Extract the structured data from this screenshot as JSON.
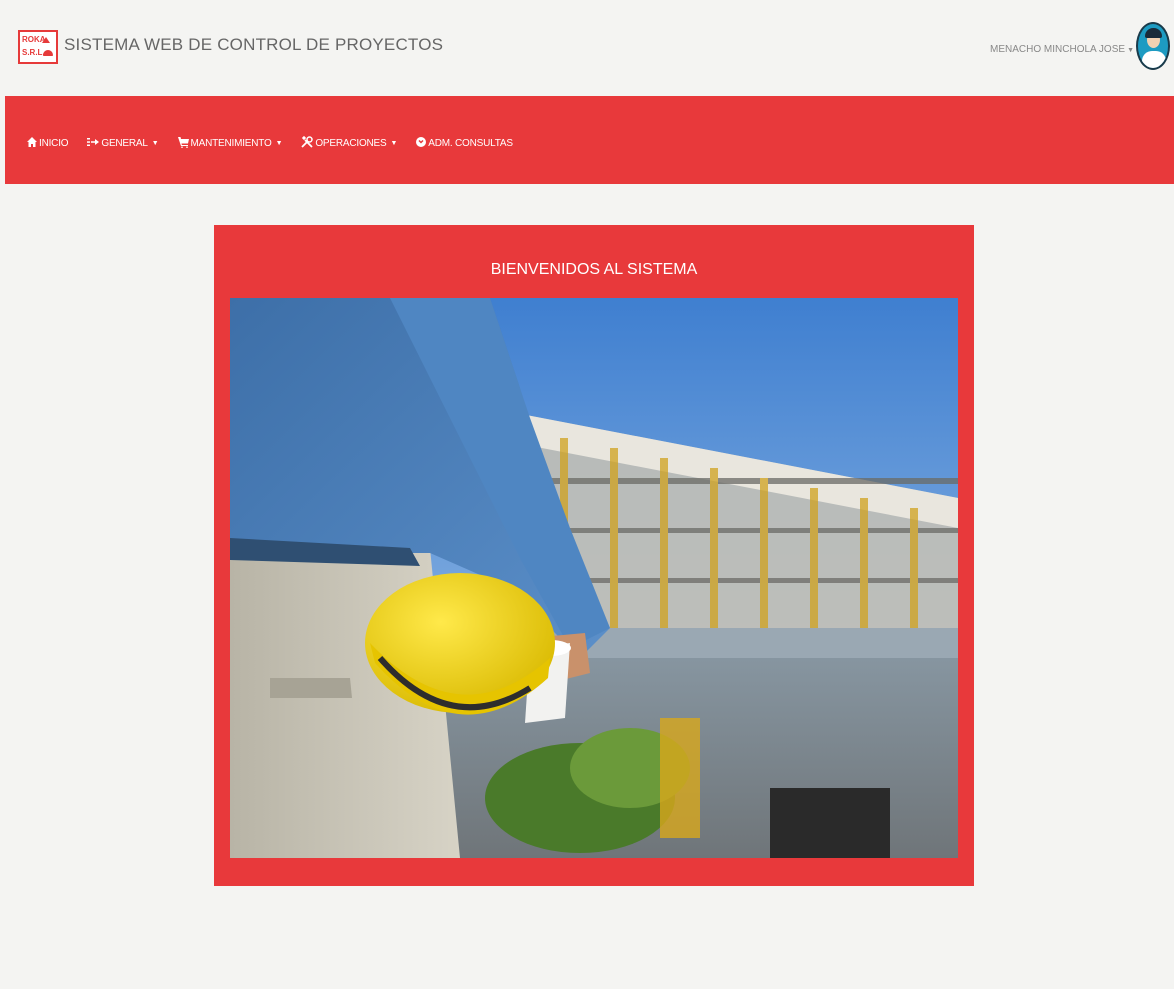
{
  "header": {
    "logo_text_line1": "ROKA",
    "logo_text_line2": "S.R.L.",
    "title": "SISTEMA WEB DE CONTROL DE PROYECTOS",
    "user_name": "MENACHO MINCHOLA JOSE"
  },
  "nav": {
    "items": [
      {
        "label": "INICIO",
        "icon": "home-icon",
        "dropdown": false
      },
      {
        "label": "GENERAL",
        "icon": "sign-in-icon",
        "dropdown": true
      },
      {
        "label": "MANTENIMIENTO",
        "icon": "cart-icon",
        "dropdown": true
      },
      {
        "label": "OPERACIONES",
        "icon": "tools-icon",
        "dropdown": true
      },
      {
        "label": "ADM. CONSULTAS",
        "icon": "circle-arrow-icon",
        "dropdown": false
      }
    ]
  },
  "main": {
    "welcome_title": "BIENVENIDOS AL SISTEMA",
    "hero_image": "construction-worker-with-helmet"
  },
  "colors": {
    "brand_red": "#e8393b",
    "background": "#f4f4f2"
  }
}
